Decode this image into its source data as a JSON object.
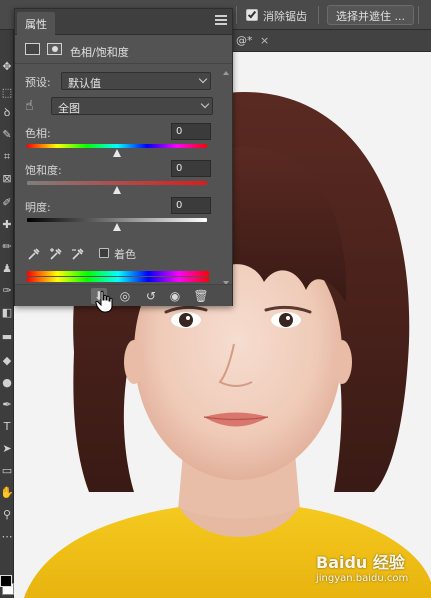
{
  "options_bar": {
    "antialias_label": "消除锯齿",
    "select_mask_label": "选择并遮住 ..."
  },
  "document": {
    "tab_label": "@",
    "close_glyph": "×",
    "modified_mark": "*"
  },
  "properties_panel": {
    "tab_label": "属性",
    "header_title": "色相/饱和度",
    "preset_label": "预设:",
    "preset_value": "默认值",
    "channel_value": "全图",
    "hue": {
      "label": "色相:",
      "value": "0",
      "level": 0.5
    },
    "saturation": {
      "label": "饱和度:",
      "value": "0",
      "level": 0.5
    },
    "lightness": {
      "label": "明度:",
      "value": "0",
      "level": 0.5
    },
    "colorize_label": "着色",
    "colorize_checked": false
  },
  "footer_icons": [
    "clip-to-layer-icon",
    "view-previous-icon",
    "reset-icon",
    "visibility-icon",
    "delete-icon"
  ],
  "watermark": {
    "brand": "Baidu 经验",
    "url": "jingyan.baidu.com"
  },
  "colors": {
    "panel_bg": "#535353",
    "chrome_dark": "#3d3d3d",
    "accent_hue_gradient": "rainbow",
    "shirt_yellow": "#f2c318",
    "hair_brown": "#4a221b"
  }
}
